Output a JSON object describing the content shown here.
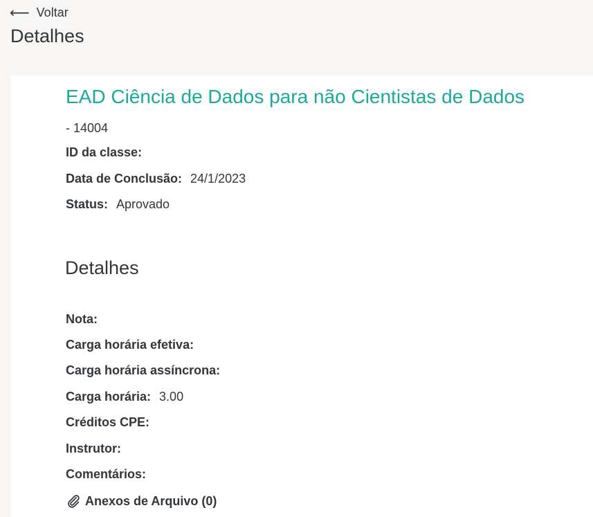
{
  "nav": {
    "back_arrow": "⟵",
    "back_label": "Voltar"
  },
  "header": {
    "title": "Detalhes"
  },
  "course": {
    "title": "EAD Ciência de Dados para não Cientistas de Dados",
    "code": "- 14004",
    "fields": [
      {
        "label": "ID da classe:",
        "value": ""
      },
      {
        "label": "Data de Conclusão:",
        "value": "24/1/2023"
      },
      {
        "label": "Status:",
        "value": "Aprovado"
      }
    ]
  },
  "details": {
    "title": "Detalhes",
    "fields": [
      {
        "label": "Nota:",
        "value": ""
      },
      {
        "label": "Carga horária efetiva:",
        "value": ""
      },
      {
        "label": "Carga horária assíncrona:",
        "value": ""
      },
      {
        "label": "Carga horária:",
        "value": "3.00"
      },
      {
        "label": "Créditos CPE:",
        "value": ""
      },
      {
        "label": "Instrutor:",
        "value": ""
      },
      {
        "label": "Comentários:",
        "value": ""
      }
    ]
  },
  "attachments": {
    "icon": "paperclip-icon",
    "label": "Anexos de Arquivo (0)"
  },
  "colors": {
    "accent": "#1ba99b",
    "text": "#32363a",
    "page_background": "#f7f6f4",
    "card_background": "#ffffff"
  }
}
